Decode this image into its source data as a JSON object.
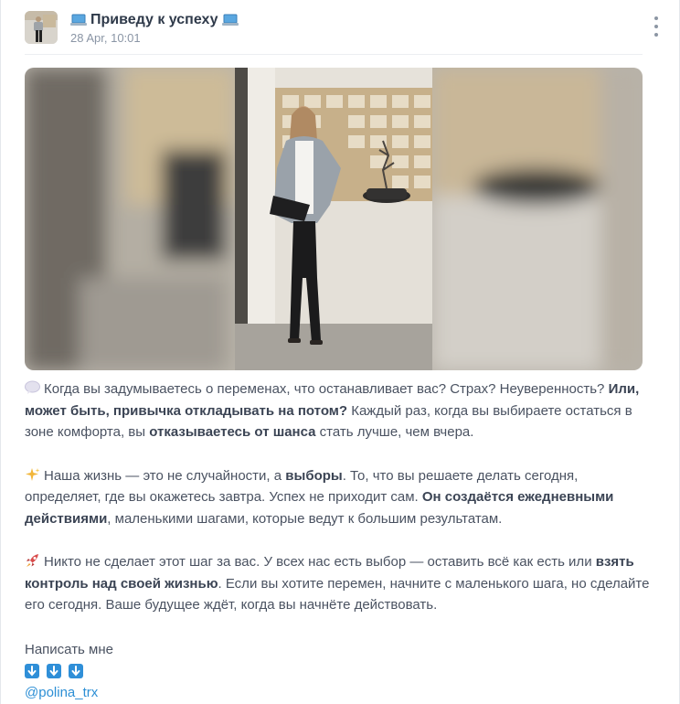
{
  "post": {
    "channel_title": "Приведу к успеху",
    "title_icon": "laptop-icon",
    "date": "28 Apr, 10:01",
    "paragraphs": [
      [
        {
          "t": "Когда вы задумываетесь о переменах, что останавливает вас? Страх? Неуверенность? ",
          "b": false
        },
        {
          "t": "Или, может быть, привычка откладывать на потом?",
          "b": true
        },
        {
          "t": " Каждый раз, когда вы выбираете остаться в зоне комфорта, вы ",
          "b": false
        },
        {
          "t": "отказываетесь от шанса",
          "b": true
        },
        {
          "t": " стать лучше, чем вчера.",
          "b": false
        }
      ],
      [
        {
          "t": "Наша жизнь — это не случайности, а ",
          "b": false
        },
        {
          "t": "выборы",
          "b": true
        },
        {
          "t": ". То, что вы решаете делать сегодня, определяет, где вы окажетесь завтра. Успех не приходит сам. ",
          "b": false
        },
        {
          "t": "Он создаётся ежедневными действиями",
          "b": true
        },
        {
          "t": ", маленькими шагами, которые ведут к большим результатам.",
          "b": false
        }
      ],
      [
        {
          "t": "Никто не сделает этот шаг за вас. У всех нас есть выбор — оставить всё как есть или ",
          "b": false
        },
        {
          "t": "взять контроль над своей жизнью",
          "b": true
        },
        {
          "t": ". Если вы хотите перемен, начните с маленького шага, но сделайте его сегодня. Ваше будущее ждёт, когда вы начнёте действовать.",
          "b": false
        }
      ]
    ],
    "paragraph_icons": [
      "speech-bubble-icon",
      "sparkles-icon",
      "rocket-icon"
    ],
    "contact_label": "Написать мне",
    "arrow_icons": [
      "arrow-down-icon",
      "arrow-down-icon",
      "arrow-down-icon"
    ],
    "contact_link": "@polina_trx"
  },
  "colors": {
    "text": "#4a5261",
    "link": "#2d8fd5",
    "muted": "#8a95a5"
  }
}
